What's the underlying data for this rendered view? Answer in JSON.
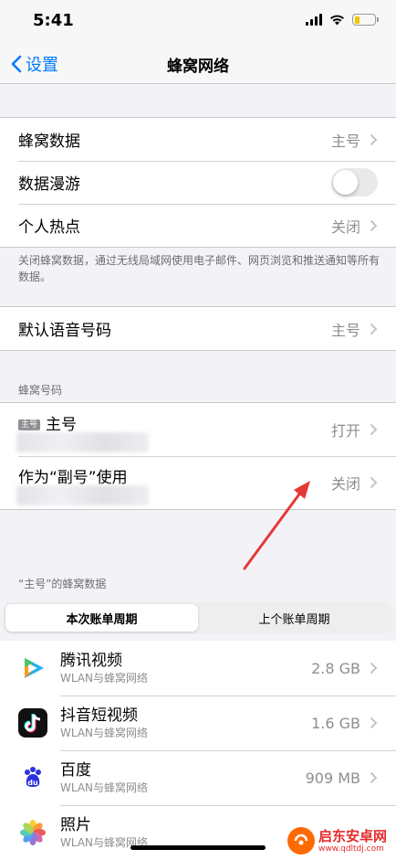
{
  "status_bar": {
    "time": "5:41"
  },
  "nav": {
    "back_label": "设置",
    "title": "蜂窝网络"
  },
  "group1": {
    "cellular_data": {
      "label": "蜂窝数据",
      "value": "主号"
    },
    "data_roaming": {
      "label": "数据漫游",
      "enabled": false
    },
    "hotspot": {
      "label": "个人热点",
      "value": "关闭"
    }
  },
  "group1_footer": "关闭蜂窝数据，通过无线局域网使用电子邮件、网页浏览和推送通知等所有数据。",
  "group2": {
    "default_voice": {
      "label": "默认语音号码",
      "value": "主号"
    }
  },
  "sim_section": {
    "header": "蜂窝号码",
    "primary": {
      "badge": "主号",
      "label": "主号",
      "value": "打开"
    },
    "secondary": {
      "label": "作为“副号”使用",
      "value": "关闭"
    }
  },
  "usage_section": {
    "header": "“主号”的蜂窝数据",
    "tabs": [
      "本次账单周期",
      "上个账单周期"
    ],
    "active_tab": 0
  },
  "apps": [
    {
      "name": "腾讯视频",
      "sub": "WLAN与蜂窝网络",
      "size": "2.8 GB",
      "icon": "tencent-video-icon"
    },
    {
      "name": "抖音短视频",
      "sub": "WLAN与蜂窝网络",
      "size": "1.6 GB",
      "icon": "douyin-icon"
    },
    {
      "name": "百度",
      "sub": "WLAN与蜂窝网络",
      "size": "909 MB",
      "icon": "baidu-icon"
    },
    {
      "name": "照片",
      "sub": "WLAN与蜂窝网络",
      "size": "",
      "icon": "photos-icon"
    }
  ],
  "watermark": {
    "title": "启东安卓网",
    "url": "www.qdltdj.com"
  },
  "colors": {
    "accent": "#007aff",
    "annotation_arrow": "#e53935",
    "battery": "#f5c400"
  }
}
